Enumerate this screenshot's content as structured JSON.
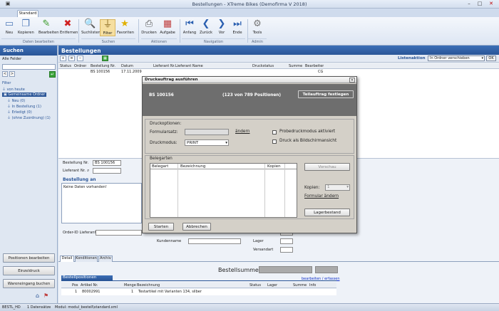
{
  "window": {
    "title": "Bestellungen - XTreme Bikes (Demofirma V 2018)",
    "minimize": "–",
    "maximize": "□",
    "close": "✕"
  },
  "tabs": {
    "active": "Standard"
  },
  "ribbon": {
    "buttons": [
      "Neu",
      "Kopieren",
      "Bearbeiten",
      "Entfernen",
      "Suchlisten",
      "Filter",
      "Favoriten",
      "Drucken",
      "Aufgabe",
      "Anfang",
      "Zurück",
      "Vor",
      "Ende",
      "Tools"
    ],
    "groups": [
      "Daten bearbeiten",
      "Suchen",
      "Aktionen",
      "Navigation",
      "Admin"
    ]
  },
  "sidebar": {
    "title": "Suchen",
    "all_fields": "Alle Felder",
    "filter_header": "Filter",
    "filters": [
      "von heute",
      "Gemeinsame Ordner",
      "Neu (0)",
      "In Bestellung (1)",
      "Erledigt (0)",
      "(ohne Zuordnung) (1)"
    ],
    "buttons": [
      "Positionen bearbeiten",
      "Einzeldruck",
      "Wareneingang buchen"
    ]
  },
  "main": {
    "title": "Bestellungen",
    "list_action_label": "Listenaktion",
    "list_action_value": "In Ordner verschieben",
    "ok": "OK",
    "columns": [
      "Status",
      "Ordner",
      "Bestellung Nr.",
      "Datum",
      "Lieferant Nr.",
      "Lieferant Name",
      "Druckstatus",
      "Summe",
      "Bearbeiter"
    ],
    "row": {
      "nr": "BS 100156",
      "datum": "17.11.2009",
      "bearbeiter": "CG"
    }
  },
  "detail": {
    "bestellung_label": "Bestellung Nr.",
    "bestellung_value": "BS 100156",
    "lieferant_label": "Lieferant Nr.",
    "bestellung_an": "Bestellung an",
    "keine_daten": "Keine Daten vorhanden!",
    "order_id_label": "Order-ID Lieferant",
    "kundenname_label": "Kundenname",
    "lager_label": "Lager",
    "versandart_label": "Versandart",
    "tabs": [
      "Detail",
      "Konditionen",
      "Archiv"
    ],
    "bestellsumme": "Bestellsumme:",
    "positionen_title": "Bestellpositionen",
    "positionen_link": "bearbeiten / erfassen",
    "pos_columns": [
      "Pos",
      "Artikel Nr.",
      "Menge",
      "Bezeichnung",
      "Status",
      "Lager",
      "Summe",
      "Info"
    ],
    "pos_row": {
      "pos": "1",
      "artikel": "80002991",
      "menge": "1",
      "bez": "Testartikel mit Varianten 134, silber"
    }
  },
  "dialog": {
    "title": "Druckauftrag ausführen",
    "nr": "BS 100156",
    "count": "(123 von 789 Positionen)",
    "teilauftrag": "Teilauftrag festlegen",
    "druckoptionen": "Druckoptionen:",
    "formularsatz": "Formularsatz:",
    "aendern": "ändern",
    "druckmodus": "Druckmodus:",
    "druckmodus_value": "PRINT",
    "probe": "Probedruckmodus aktiviert",
    "bildschirm": "Druck als Bildschirmansicht",
    "belegarten": "Belegarten",
    "bel_cols": [
      "Belegart",
      "Bezeichnung",
      "Kopien"
    ],
    "vorschau": "Vorschau",
    "kopien": "Kopien:",
    "kopien_value": "1",
    "formular_aendern": "Formular ändern",
    "lagerbestand": "Lagerbestand",
    "starten": "Starten",
    "abbrechen": "Abbrechen"
  },
  "status": {
    "left": "BESTL_HD",
    "count": "1 Datensätze",
    "modul": "Modul: modul_bestell\\standard.xml"
  },
  "colors": {
    "accent": "#2a5597",
    "dialog_header": "#6e6e6e",
    "link": "#1030c8"
  },
  "icons": [
    "new-icon",
    "copy-icon",
    "edit-icon",
    "delete-icon",
    "search-icon",
    "filter-icon",
    "star-icon",
    "print-icon",
    "task-icon",
    "first-icon",
    "back-icon",
    "forward-icon",
    "last-icon",
    "gear-icon"
  ]
}
